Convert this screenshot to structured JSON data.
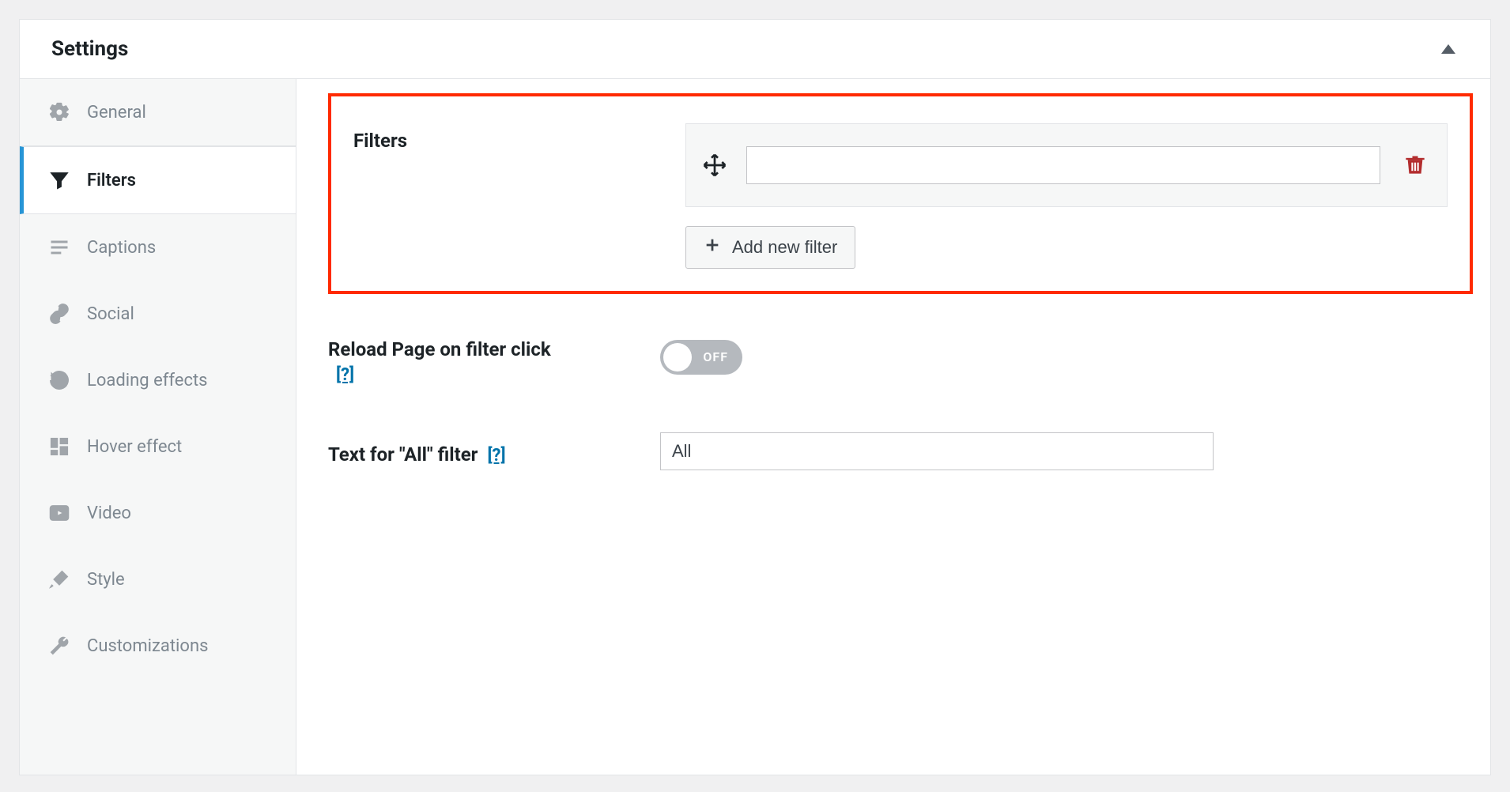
{
  "panel": {
    "title": "Settings"
  },
  "sidebar": {
    "items": [
      {
        "label": "General"
      },
      {
        "label": "Filters"
      },
      {
        "label": "Captions"
      },
      {
        "label": "Social"
      },
      {
        "label": "Loading effects"
      },
      {
        "label": "Hover effect"
      },
      {
        "label": "Video"
      },
      {
        "label": "Style"
      },
      {
        "label": "Customizations"
      }
    ],
    "active_index": 1
  },
  "filters": {
    "heading": "Filters",
    "items": [
      {
        "value": ""
      }
    ],
    "add_button_label": "Add new filter"
  },
  "reload": {
    "label": "Reload Page on filter click",
    "help": "[?]",
    "toggle_state": "OFF"
  },
  "all_filter": {
    "label": "Text for \"All\" filter",
    "help": "[?]",
    "value": "All"
  }
}
